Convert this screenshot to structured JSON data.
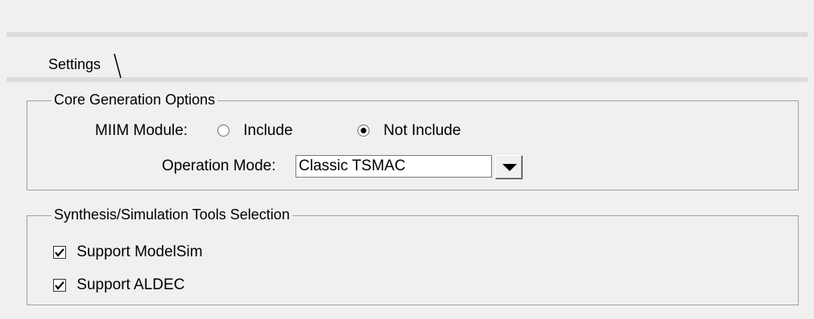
{
  "tabs": [
    {
      "label": "Settings"
    }
  ],
  "core_generation": {
    "legend": "Core Generation Options",
    "miim_label": "MIIM Module:",
    "miim_options": [
      {
        "label": "Include",
        "selected": false
      },
      {
        "label": "Not Include",
        "selected": true
      }
    ],
    "operation_mode_label": "Operation Mode:",
    "operation_mode_value": "Classic TSMAC"
  },
  "synthesis": {
    "legend": "Synthesis/Simulation Tools Selection",
    "options": [
      {
        "label": "Support ModelSim",
        "checked": true
      },
      {
        "label": "Support ALDEC",
        "checked": true
      }
    ]
  },
  "icons": {
    "dropdown": "triangle-down-icon",
    "check": "checkmark-icon"
  }
}
